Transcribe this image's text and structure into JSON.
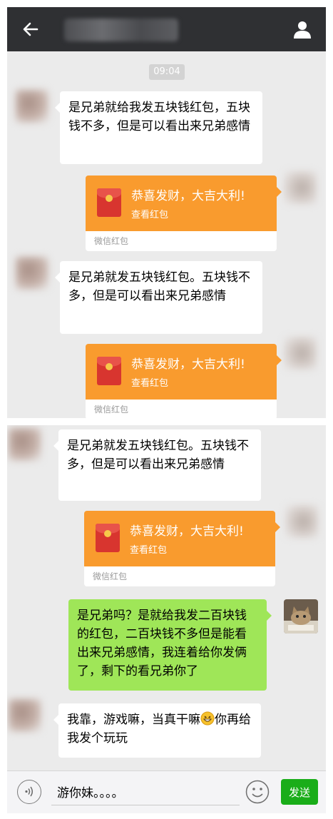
{
  "header": {
    "icon": "back-arrow-icon",
    "profile_icon": "person-icon"
  },
  "timestamp": "09:04",
  "panel1": {
    "msg1": "是兄弟就给我发五块钱红包，五块钱不多，但是可以看出来兄弟感情",
    "red_packet_1": {
      "title": "恭喜发财，大吉大利!",
      "action": "查看红包",
      "footer": "微信红包"
    },
    "msg2": "是兄弟就发五块钱红包。五块钱不多，但是可以看出来兄弟感情",
    "red_packet_2": {
      "title": "恭喜发财，大吉大利!",
      "action": "查看红包",
      "footer": "微信红包"
    }
  },
  "panel2": {
    "msg3": "是兄弟就发五块钱红包。五块钱不多，但是可以看出来兄弟感情",
    "red_packet_3": {
      "title": "恭喜发财，大吉大利!",
      "action": "查看红包",
      "footer": "微信红包"
    },
    "msg4": "是兄弟吗？是就给我发二百块钱的红包，二百块钱不多但是能看出来兄弟感情，我连着给你发俩了，剩下的看兄弟你了",
    "msg5_part1": "我靠，游戏嘛，当真干嘛",
    "msg5_emoji": "grinning-face-icon",
    "msg5_part2": "你再给我发个玩玩"
  },
  "input_bar": {
    "voice_icon": "voice-icon",
    "input_value": "游你妹。。。。",
    "emoji_icon": "smiley-icon",
    "send_label": "发送"
  },
  "colors": {
    "header": "#2f3033",
    "chat_bg": "#ebebeb",
    "red_packet": "#f99b2e",
    "outgoing_bubble": "#9fe658",
    "send_button": "#1aad19"
  }
}
